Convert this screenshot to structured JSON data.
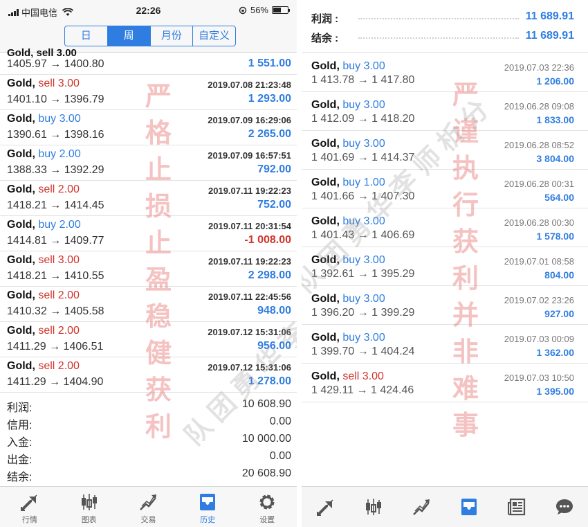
{
  "left": {
    "status": {
      "carrier": "中国电信",
      "time": "22:26",
      "battery": "56%",
      "battery_level": 0.56
    },
    "tabs": [
      {
        "label": "日",
        "active": false
      },
      {
        "label": "周",
        "active": true
      },
      {
        "label": "月份",
        "active": false
      },
      {
        "label": "自定义",
        "active": false
      }
    ],
    "clipped_prev": "Gold, sell 3.00",
    "trades": [
      {
        "symbol": "",
        "action": "",
        "side": "",
        "time": "",
        "prices": "1405.97 → 1400.80",
        "profit": "1 551.00",
        "neg": false,
        "partial": true
      },
      {
        "symbol": "Gold,",
        "action": "sell 3.00",
        "side": "sell",
        "time": "2019.07.08 21:23:48",
        "prices": "1401.10 → 1396.79",
        "profit": "1 293.00",
        "neg": false
      },
      {
        "symbol": "Gold,",
        "action": "buy 3.00",
        "side": "buy",
        "time": "2019.07.09 16:29:06",
        "prices": "1390.61 → 1398.16",
        "profit": "2 265.00",
        "neg": false
      },
      {
        "symbol": "Gold,",
        "action": "buy 2.00",
        "side": "buy",
        "time": "2019.07.09 16:57:51",
        "prices": "1388.33 → 1392.29",
        "profit": "792.00",
        "neg": false
      },
      {
        "symbol": "Gold,",
        "action": "sell 2.00",
        "side": "sell",
        "time": "2019.07.11 19:22:23",
        "prices": "1418.21 → 1414.45",
        "profit": "752.00",
        "neg": false
      },
      {
        "symbol": "Gold,",
        "action": "buy 2.00",
        "side": "buy",
        "time": "2019.07.11 20:31:54",
        "prices": "1414.81 → 1409.77",
        "profit": "-1 008.00",
        "neg": true
      },
      {
        "symbol": "Gold,",
        "action": "sell 3.00",
        "side": "sell",
        "time": "2019.07.11 19:22:23",
        "prices": "1418.21 → 1410.55",
        "profit": "2 298.00",
        "neg": false
      },
      {
        "symbol": "Gold,",
        "action": "sell 2.00",
        "side": "sell",
        "time": "2019.07.11 22:45:56",
        "prices": "1410.32 → 1405.58",
        "profit": "948.00",
        "neg": false
      },
      {
        "symbol": "Gold,",
        "action": "sell 2.00",
        "side": "sell",
        "time": "2019.07.12 15:31:06",
        "prices": "1411.29 → 1406.51",
        "profit": "956.00",
        "neg": false
      },
      {
        "symbol": "Gold,",
        "action": "sell 2.00",
        "side": "sell",
        "time": "2019.07.12 15:31:06",
        "prices": "1411.29 → 1404.90",
        "profit": "1 278.00",
        "neg": false
      }
    ],
    "summary": [
      {
        "label": "利润:",
        "value": "10 608.90"
      },
      {
        "label": "信用:",
        "value": "0.00"
      },
      {
        "label": "入金:",
        "value": "10 000.00"
      },
      {
        "label": "出金:",
        "value": "0.00"
      },
      {
        "label": "结余:",
        "value": "20 608.90"
      }
    ],
    "bottom_tabs": [
      {
        "label": "行情",
        "icon": "quotes-icon",
        "active": false
      },
      {
        "label": "图表",
        "icon": "candlestick-chart-icon",
        "active": false
      },
      {
        "label": "交易",
        "icon": "trade-icon",
        "active": false
      },
      {
        "label": "历史",
        "icon": "history-inbox-icon",
        "active": true
      },
      {
        "label": "设置",
        "icon": "gear-icon",
        "active": false
      }
    ],
    "watermark_red": [
      "严",
      "格",
      "止",
      "损",
      "止",
      "盈",
      "稳",
      "健",
      "获",
      "利"
    ],
    "watermark_gray": "队团勇华李师析分"
  },
  "right": {
    "summary": [
      {
        "label": "利润 :",
        "value": "11 689.91"
      },
      {
        "label": "结余 :",
        "value": "11 689.91"
      }
    ],
    "trades": [
      {
        "symbol": "Gold,",
        "action": "buy 3.00",
        "side": "buy",
        "time": "2019.07.03 22:36",
        "prices": "1 413.78 → 1 417.80",
        "profit": "1 206.00"
      },
      {
        "symbol": "Gold,",
        "action": "buy 3.00",
        "side": "buy",
        "time": "2019.06.28 09:08",
        "prices": "1 412.09 → 1 418.20",
        "profit": "1 833.00"
      },
      {
        "symbol": "Gold,",
        "action": "buy 3.00",
        "side": "buy",
        "time": "2019.06.28 08:52",
        "prices": "1 401.69 → 1 414.37",
        "profit": "3 804.00"
      },
      {
        "symbol": "Gold,",
        "action": "buy 1.00",
        "side": "buy",
        "time": "2019.06.28 00:31",
        "prices": "1 401.66 → 1 407.30",
        "profit": "564.00"
      },
      {
        "symbol": "Gold,",
        "action": "buy 3.00",
        "side": "buy",
        "time": "2019.06.28 00:30",
        "prices": "1 401.43 → 1 406.69",
        "profit": "1 578.00"
      },
      {
        "symbol": "Gold,",
        "action": "buy 3.00",
        "side": "buy",
        "time": "2019.07.01 08:58",
        "prices": "1 392.61 → 1 395.29",
        "profit": "804.00"
      },
      {
        "symbol": "Gold,",
        "action": "buy 3.00",
        "side": "buy",
        "time": "2019.07.02 23:26",
        "prices": "1 396.20 → 1 399.29",
        "profit": "927.00"
      },
      {
        "symbol": "Gold,",
        "action": "buy 3.00",
        "side": "buy",
        "time": "2019.07.03 00:09",
        "prices": "1 399.70 → 1 404.24",
        "profit": "1 362.00"
      },
      {
        "symbol": "Gold,",
        "action": "sell 3.00",
        "side": "sell",
        "time": "2019.07.03 10:50",
        "prices": "1 429.11 → 1 424.46",
        "profit": "1 395.00"
      }
    ],
    "bottom_tabs": [
      {
        "icon": "quotes-icon",
        "active": false
      },
      {
        "icon": "candlestick-chart-icon",
        "active": false
      },
      {
        "icon": "trade-icon",
        "active": false
      },
      {
        "icon": "history-inbox-icon",
        "active": true
      },
      {
        "icon": "news-icon",
        "active": false
      },
      {
        "icon": "chat-icon",
        "active": false
      }
    ],
    "watermark_red": [
      "严",
      "谨",
      "执",
      "行",
      "获",
      "利",
      "并",
      "非",
      "难",
      "事"
    ]
  },
  "colors": {
    "accent": "#2f7de1",
    "loss": "#d0342c",
    "sell": "#d0342c",
    "buy": "#2f7de1"
  }
}
